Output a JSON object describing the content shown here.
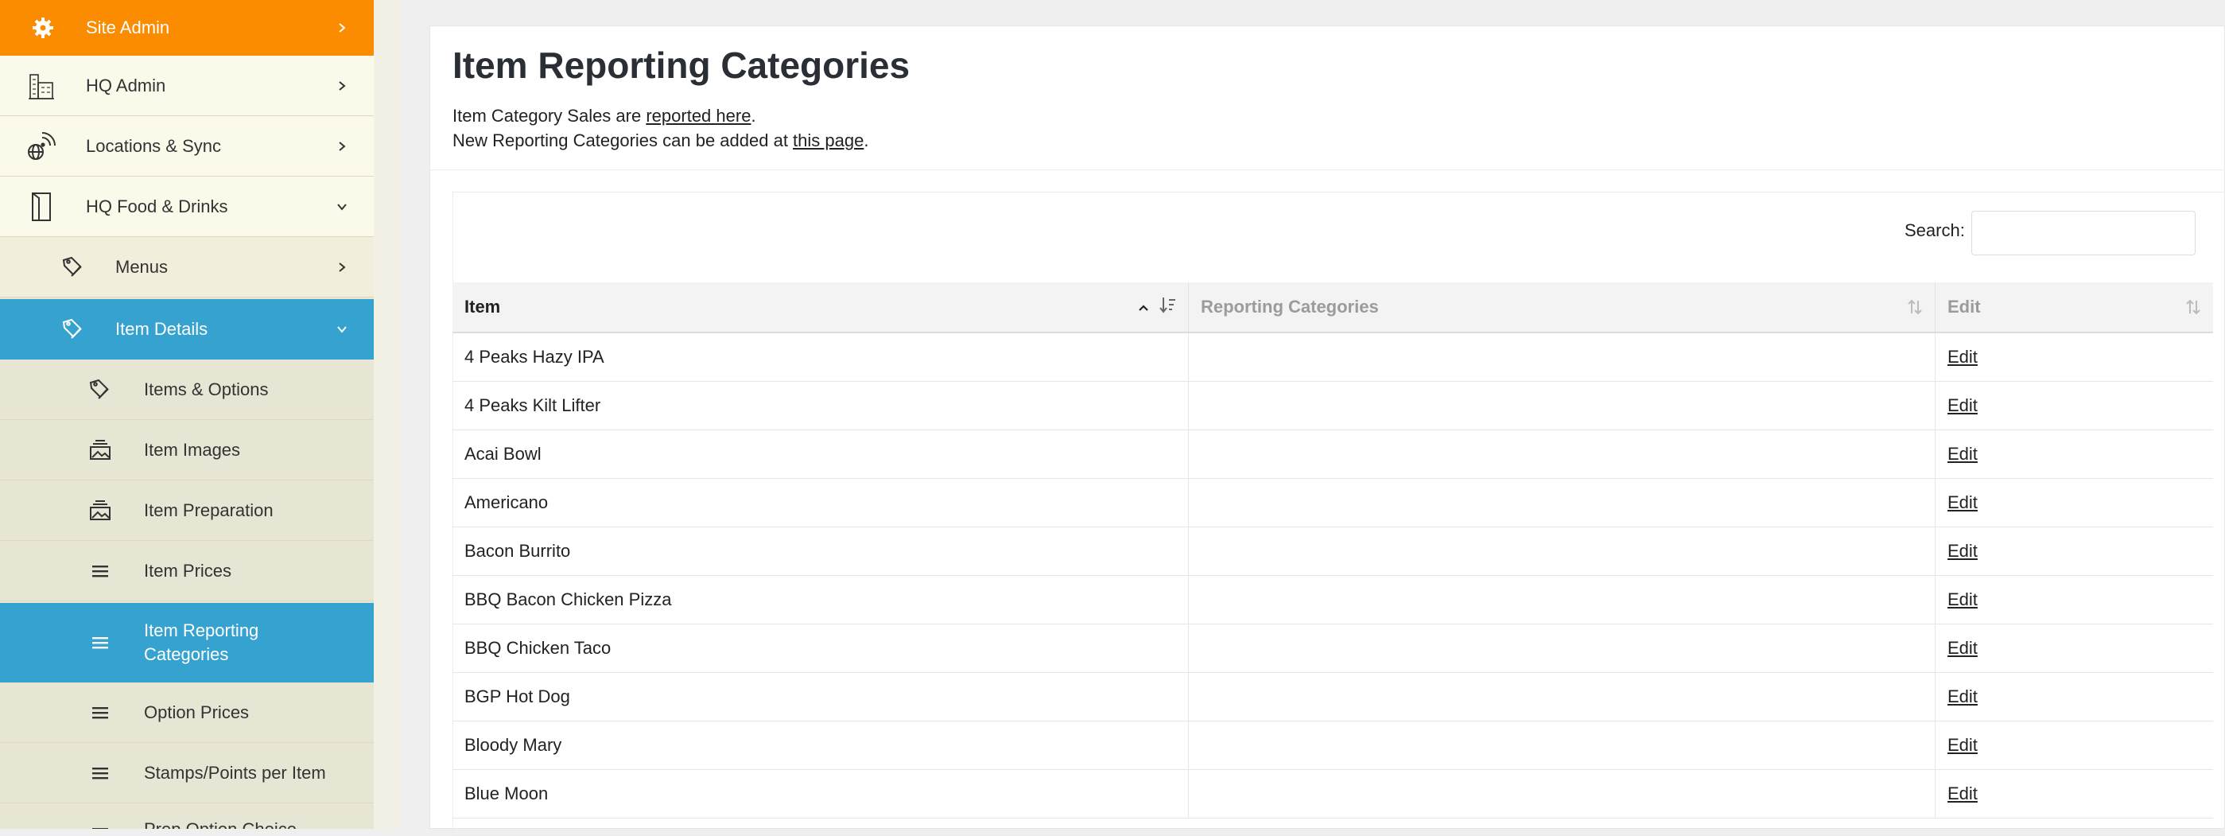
{
  "sidebar": {
    "items": [
      {
        "label": "Site Admin",
        "icon": "gear-icon"
      },
      {
        "label": "HQ Admin",
        "icon": "building-icon"
      },
      {
        "label": "Locations & Sync",
        "icon": "broadcast-globe-icon"
      },
      {
        "label": "HQ Food & Drinks",
        "icon": "book-icon"
      },
      {
        "label": "Menus",
        "icon": "tags-icon"
      },
      {
        "label": "Item Details",
        "icon": "tags-icon"
      },
      {
        "label": "Items & Options",
        "icon": "tags-icon"
      },
      {
        "label": "Item Images",
        "icon": "image-stack-icon"
      },
      {
        "label": "Item Preparation",
        "icon": "image-stack-icon"
      },
      {
        "label": "Item Prices",
        "icon": "list-icon"
      },
      {
        "label": "Item Reporting Categories",
        "icon": "list-icon"
      },
      {
        "label": "Option Prices",
        "icon": "list-icon"
      },
      {
        "label": "Stamps/Points per Item",
        "icon": "list-icon"
      },
      {
        "label": "Prep Option Choice",
        "icon": "list-icon"
      }
    ]
  },
  "main": {
    "title": "Item Reporting Categories",
    "intro1_prefix": "Item Category Sales are ",
    "intro1_link": "reported here",
    "intro1_suffix": ".",
    "intro2_prefix": "New Reporting Categories can be added at ",
    "intro2_link": "this page",
    "intro2_suffix": ".",
    "search_label": "Search:",
    "search_value": ""
  },
  "table": {
    "columns": [
      "Item",
      "Reporting Categories",
      "Edit"
    ],
    "edit_label": "Edit",
    "rows": [
      {
        "item": "4 Peaks Hazy IPA",
        "category": ""
      },
      {
        "item": "4 Peaks Kilt Lifter",
        "category": ""
      },
      {
        "item": "Acai Bowl",
        "category": ""
      },
      {
        "item": "Americano",
        "category": ""
      },
      {
        "item": "Bacon Burrito",
        "category": ""
      },
      {
        "item": "BBQ Bacon Chicken Pizza",
        "category": ""
      },
      {
        "item": "BBQ Chicken Taco",
        "category": ""
      },
      {
        "item": "BGP Hot Dog",
        "category": ""
      },
      {
        "item": "Bloody Mary",
        "category": ""
      },
      {
        "item": "Blue Moon",
        "category": ""
      }
    ]
  },
  "colors": {
    "site_admin_bg": "#fb8c00",
    "active_bg": "#35a2cf",
    "sidebar_bg": "#e9e6d2"
  }
}
